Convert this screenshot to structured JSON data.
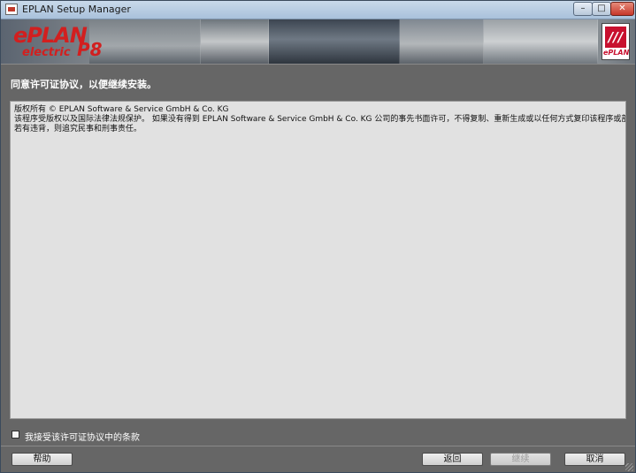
{
  "window": {
    "title": "EPLAN Setup Manager",
    "controls": {
      "minimize": "–",
      "maximize": "□",
      "close": "✕"
    }
  },
  "banner": {
    "logo_line1": "ePLAN",
    "logo_line2": "electric",
    "logo_version": "P8",
    "brand_mark": "///",
    "brand_text": "ePLAN"
  },
  "heading": "同意许可证协议，以便继续安装。",
  "license": {
    "lines": [
      "版权所有 © EPLAN Software & Service GmbH & Co. KG",
      "该程序受版权以及国际法律法规保护。  如果没有得到 EPLAN Software &  Service GmbH & Co. KG 公司的事先书面许可，不得复制、重新生成或以任何方式复印该程序或部分程序。",
      "若有违背，则追究民事和刑事责任。"
    ]
  },
  "accept": {
    "label": "我接受该许可证协议中的条款",
    "checked": false
  },
  "buttons": {
    "help": "帮助",
    "back": "返回",
    "continue": "继续",
    "cancel": "取消"
  },
  "colors": {
    "background": "#666666",
    "license_bg": "#e1e1e1",
    "brand_red": "#c8102e"
  }
}
